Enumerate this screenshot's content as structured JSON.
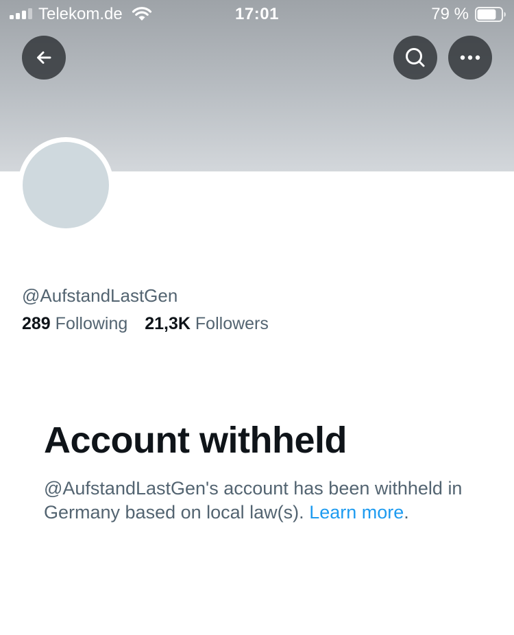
{
  "status_bar": {
    "carrier": "Telekom.de",
    "time": "17:01",
    "battery_percent": "79 %",
    "battery_level": 0.79
  },
  "nav": {
    "back_icon": "arrow-left-icon",
    "search_icon": "search-icon",
    "more_icon": "more-horizontal-icon"
  },
  "profile": {
    "handle": "@AufstandLastGen",
    "following_count": "289",
    "following_label": "Following",
    "followers_count": "21,3K",
    "followers_label": "Followers"
  },
  "withheld": {
    "title": "Account withheld",
    "message": "@AufstandLastGen's account has been withheld in Germany based on local law(s).",
    "link": "Learn more",
    "link_suffix": "."
  },
  "colors": {
    "text_primary": "#0f1419",
    "text_secondary": "#536471",
    "link": "#1d9bf0",
    "avatar_placeholder": "#cfd9de"
  }
}
